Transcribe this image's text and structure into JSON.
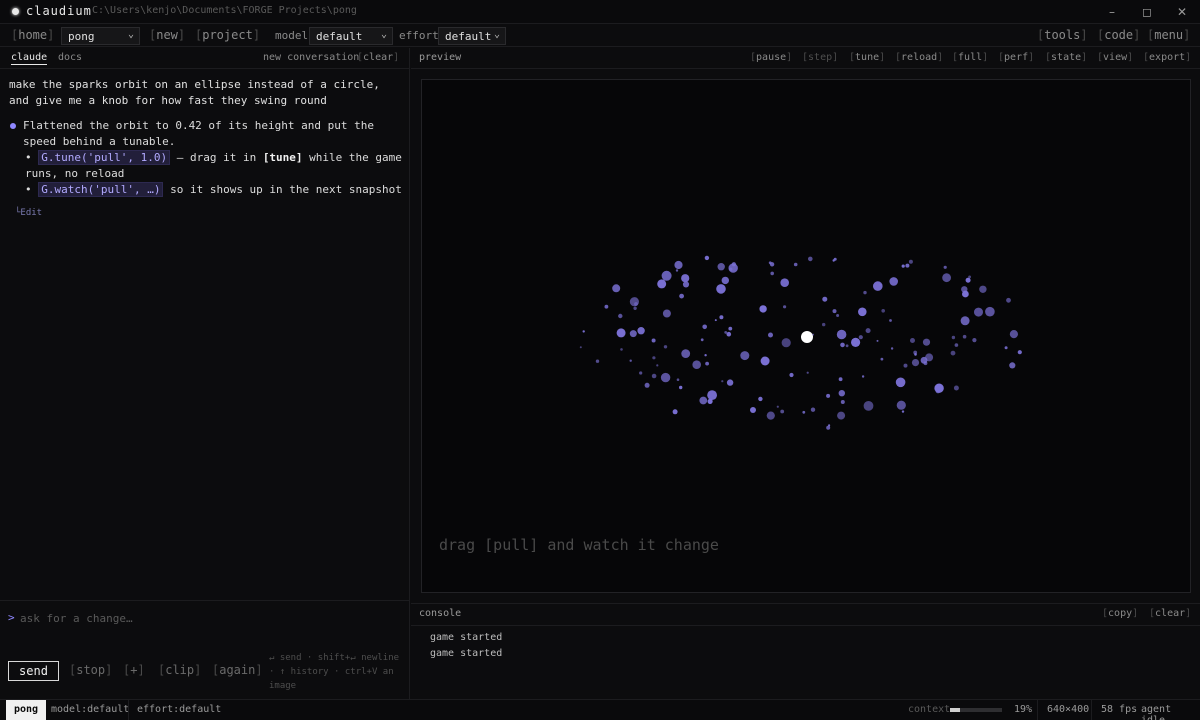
{
  "titlebar": {
    "app_name": "claudium",
    "path": "C:\\Users\\kenjo\\Documents\\FORGE Projects\\pong",
    "minimize": "–",
    "maximize": "◻",
    "close": "✕"
  },
  "toolbar": {
    "home": "home",
    "project_select": "pong",
    "new": "new",
    "project": "project",
    "model_label": "model",
    "model_select": "default",
    "effort_label": "effort",
    "effort_select": "default",
    "tools": "tools",
    "code": "code",
    "menu": "menu"
  },
  "left_tabs": {
    "claude": "claude",
    "docs": "docs",
    "new_conversation": "new conversation",
    "clear": "clear"
  },
  "conversation": {
    "user_message": "make the sparks orbit on an ellipse instead of a circle, and give me a knob for how fast they swing round",
    "response_intro": "Flattened the orbit to 0.42 of its height and put the speed behind a tunable.",
    "bullet1_code": "G.tune('pull', 1.0)",
    "bullet1_dash": " — drag it in ",
    "bullet1_bold": "[tune]",
    "bullet1_rest": " while the game runs, no reload",
    "bullet2_code": "G.watch('pull', …)",
    "bullet2_rest": " so it shows up in the next snapshot",
    "edit_link": "└Edit"
  },
  "input": {
    "caret": ">",
    "placeholder": "ask for a change…",
    "send": "send",
    "stop": "stop",
    "add": "+",
    "clip": "clip",
    "again": "again",
    "hints": "↵ send · shift+↵ newline · ↑ history · ctrl+V an image"
  },
  "preview": {
    "label": "preview",
    "buttons": [
      "pause",
      "step",
      "tune",
      "reload",
      "full",
      "perf",
      "state",
      "view",
      "export"
    ],
    "caption": "drag [pull] and watch it change"
  },
  "console": {
    "label": "console",
    "copy": "copy",
    "clear": "clear",
    "lines": [
      "game started",
      "game started"
    ]
  },
  "statusbar": {
    "project": "pong",
    "model": "model:default",
    "effort": "effort:default",
    "context_label": "context",
    "context_percent": "19%",
    "context_fraction": 0.19,
    "resolution": "640×400",
    "fps": "58 fps",
    "agent_status": "agent idle"
  },
  "colors": {
    "accent": "#8f87ff",
    "spark": "#7b71d6",
    "ball": "#ffffff",
    "background": "#0c0c0e"
  }
}
